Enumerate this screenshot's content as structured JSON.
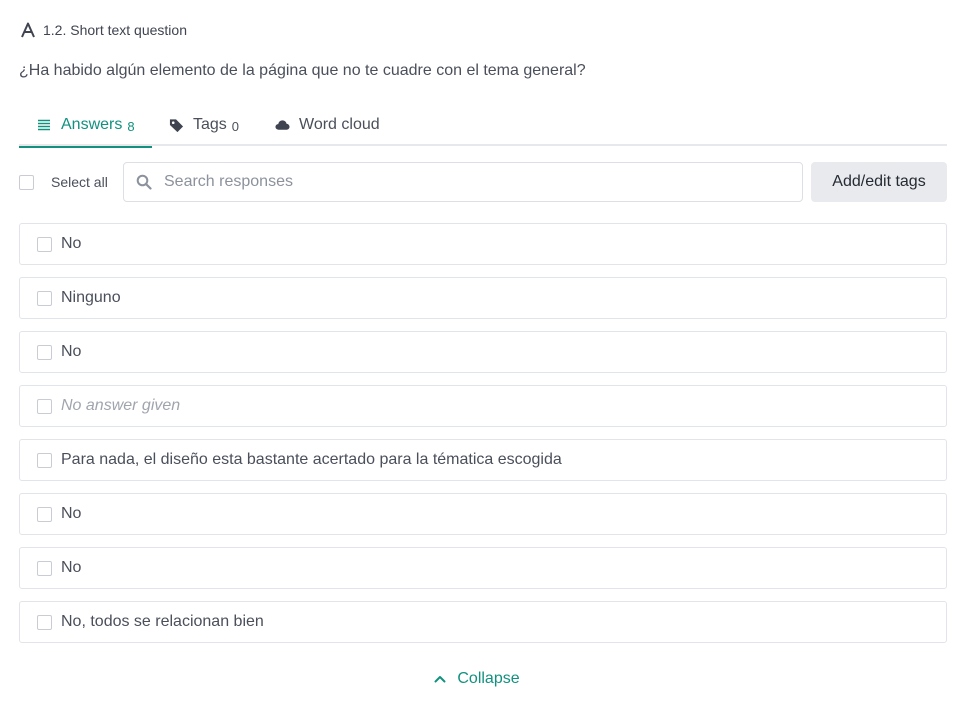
{
  "question": {
    "type_label": "1.2. Short text question",
    "text": "¿Ha habido algún elemento de la página que no te cuadre con el tema general?"
  },
  "tabs": {
    "answers": {
      "label": "Answers",
      "count": "8"
    },
    "tags": {
      "label": "Tags",
      "count": "0"
    },
    "word_cloud": {
      "label": "Word cloud"
    }
  },
  "toolbar": {
    "select_all_label": "Select all",
    "search_placeholder": "Search responses",
    "search_value": "",
    "tags_button_label": "Add/edit tags"
  },
  "answers": [
    {
      "text": "No",
      "empty": false
    },
    {
      "text": "Ninguno",
      "empty": false
    },
    {
      "text": "No",
      "empty": false
    },
    {
      "text": "No answer given",
      "empty": true
    },
    {
      "text": "Para nada, el diseño esta bastante acertado para la tématica escogida",
      "empty": false
    },
    {
      "text": "No",
      "empty": false
    },
    {
      "text": "No",
      "empty": false
    },
    {
      "text": "No, todos se relacionan bien",
      "empty": false
    }
  ],
  "collapse_label": "Collapse",
  "colors": {
    "accent": "#12917f",
    "text": "#4a4f5a",
    "border": "#e1e4e8",
    "button_bg": "#e8eaed"
  },
  "icons": {
    "question_type": "text-a-icon",
    "answers_tab": "list-lines-icon",
    "tags_tab": "tag-icon",
    "word_cloud_tab": "cloud-icon",
    "search": "search-icon",
    "collapse": "chevron-up-icon"
  }
}
